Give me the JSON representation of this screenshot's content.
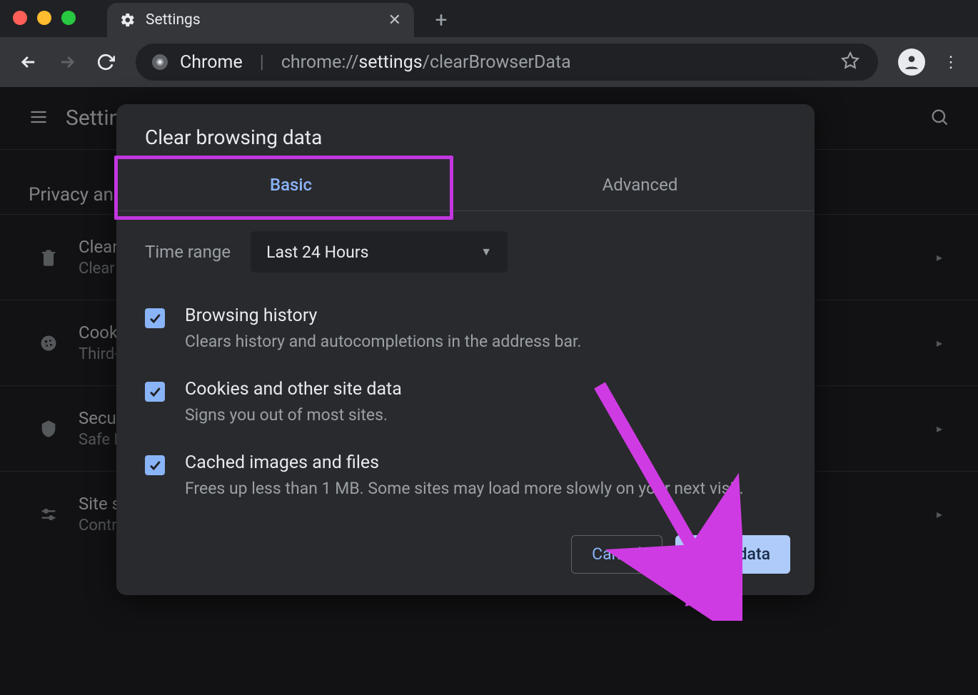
{
  "window": {
    "tab_title": "Settings"
  },
  "toolbar": {
    "url_product": "Chrome",
    "url_scheme": "chrome://",
    "url_host": "settings",
    "url_path": "/clearBrowserData"
  },
  "background": {
    "app_title": "Settings",
    "section": "Privacy and security",
    "rows": [
      {
        "title": "Clear browsing data",
        "sub": "Clear history, cookies, cache, and more"
      },
      {
        "title": "Cookies and other site data",
        "sub": "Third-party cookies are blocked in Incognito mode"
      },
      {
        "title": "Security",
        "sub": "Safe Browsing (protection from dangerous sites) and other security settings"
      },
      {
        "title": "Site settings",
        "sub": "Controls what information sites can use and show"
      }
    ]
  },
  "dialog": {
    "title": "Clear browsing data",
    "tabs": {
      "basic": "Basic",
      "advanced": "Advanced"
    },
    "time_range_label": "Time range",
    "time_range_value": "Last 24 Hours",
    "items": [
      {
        "title": "Browsing history",
        "sub": "Clears history and autocompletions in the address bar."
      },
      {
        "title": "Cookies and other site data",
        "sub": "Signs you out of most sites."
      },
      {
        "title": "Cached images and files",
        "sub": "Frees up less than 1 MB. Some sites may load more slowly on your next visit."
      }
    ],
    "cancel": "Cancel",
    "confirm": "Clear data"
  }
}
